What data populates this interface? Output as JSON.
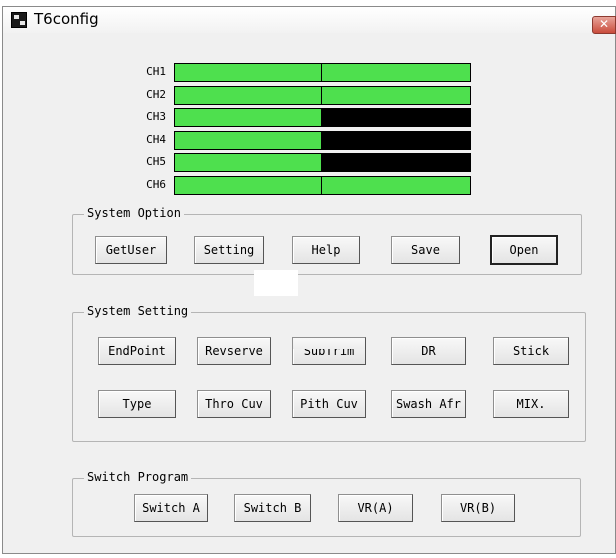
{
  "window": {
    "title": "T6config",
    "close_label": "✕"
  },
  "channels": [
    {
      "label": "CH1",
      "left_on": true,
      "right_on": true
    },
    {
      "label": "CH2",
      "left_on": true,
      "right_on": true
    },
    {
      "label": "CH3",
      "left_on": true,
      "right_on": false
    },
    {
      "label": "CH4",
      "left_on": true,
      "right_on": false
    },
    {
      "label": "CH5",
      "left_on": true,
      "right_on": false
    },
    {
      "label": "CH6",
      "left_on": true,
      "right_on": true
    }
  ],
  "system_option": {
    "title": "System Option",
    "buttons": [
      "GetUser",
      "Setting",
      "Help",
      "Save",
      "Open"
    ]
  },
  "system_setting": {
    "title": "System Setting",
    "row1": [
      "EndPoint",
      "Revserve",
      "SubTrim",
      "DR",
      "Stick"
    ],
    "row2": [
      "Type",
      "Thro Cuv",
      "Pith Cuv",
      "Swash Afr",
      "MIX."
    ]
  },
  "switch_program": {
    "title": "Switch Program",
    "buttons": [
      "Switch A",
      "Switch B",
      "VR(A)",
      "VR(B)"
    ]
  },
  "colors": {
    "channel_on": "#4ee04e",
    "channel_off": "#000000",
    "dialog_bg": "#f0f0f0"
  },
  "icons": {
    "app": "t6config-app-icon",
    "close": "close-icon"
  }
}
